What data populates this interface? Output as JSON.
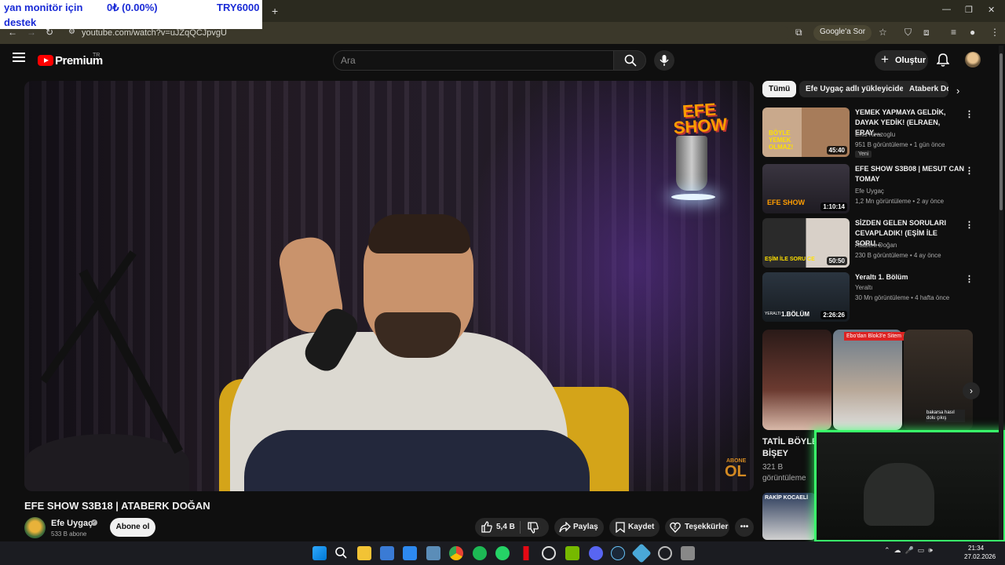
{
  "overlay": {
    "line1": "yan monitör için",
    "line2": "destek",
    "amount": "0₺ (0.00%)",
    "goal": "TRY6000"
  },
  "browser": {
    "new_tab": "+",
    "url": "youtube.com/watch?v=uJZqQCJpvgU",
    "google_sor": "Google'a Sor",
    "window_minimize": "—",
    "window_maximize": "❐",
    "window_close": "✕"
  },
  "header": {
    "logo": "Premium",
    "logo_region": "TR",
    "search_placeholder": "Ara",
    "create_label": "Oluştur",
    "create_plus": "+"
  },
  "video": {
    "title": "EFE SHOW S3B18 | ATABERK DOĞAN",
    "channel": "Efe Uygaç",
    "subscribers": "533 B abone",
    "subscribe_label": "Abone ol",
    "likes": "5,4 B",
    "share_label": "Paylaş",
    "save_label": "Kaydet",
    "thanks_label": "Teşekkürler",
    "more_label": "•••",
    "overlay_logo_line1": "EFE",
    "overlay_logo_line2": "SHOW",
    "overlay_abone": "ABONE",
    "overlay_ol": "OL"
  },
  "sidebar": {
    "chips": [
      "Tümü",
      "Efe Uygaç adlı yükleyiciden",
      "Ataberk Doğan"
    ],
    "recommendations": [
      {
        "title": "YEMEK YAPMAYA GELDİK, DAYAK YEDİK! (ELRAEN, ERAY,...",
        "channel": "Enis Kirazoglu",
        "meta": "951 B görüntüleme • 1 gün önce",
        "duration": "45:40",
        "badge": "Yeni",
        "thumb_text": "BÖYLE YEMEK OLMAZ!"
      },
      {
        "title": "EFE SHOW S3B08 | MESUT CAN TOMAY",
        "channel": "Efe Uygaç",
        "meta": "1,2 Mn görüntüleme • 2 ay önce",
        "duration": "1:10:14",
        "thumb_text": "EFE SHOW"
      },
      {
        "title": "SİZDEN GELEN SORULARI CEVAPLADIK! (EŞİM İLE SORU...",
        "channel": "Ataberk Doğan",
        "meta": "230 B görüntüleme • 4 ay önce",
        "duration": "50:50",
        "thumb_text": "EŞİM İLE SORU CE"
      },
      {
        "title": "Yeraltı 1. Bölüm",
        "channel": "Yeraltı",
        "meta": "30 Mn görüntüleme • 4 hafta önce",
        "duration": "2:26:26",
        "thumb_text": "1.BÖLÜM",
        "thumb_corner": "YERALTI"
      }
    ],
    "shorts": {
      "label": "Ebo'dan Blok3'e Sitem 😮",
      "title_line1": "TATİL BÖYLE",
      "title_line2": "BİŞEY",
      "views_line1": "321 B",
      "views_line2": "görüntüleme",
      "third_caption": "bakarsa hasıl dolu çıkış",
      "next_arrow": "›"
    },
    "extra_thumb_text": "RAKİP KOCAELİ"
  },
  "taskbar": {
    "time": "21:34",
    "date": "27.02.2026"
  },
  "colors": {
    "accent_red": "#ff0000",
    "webcam_border": "#39ff6a",
    "overlay_text": "#1a2bd6"
  }
}
